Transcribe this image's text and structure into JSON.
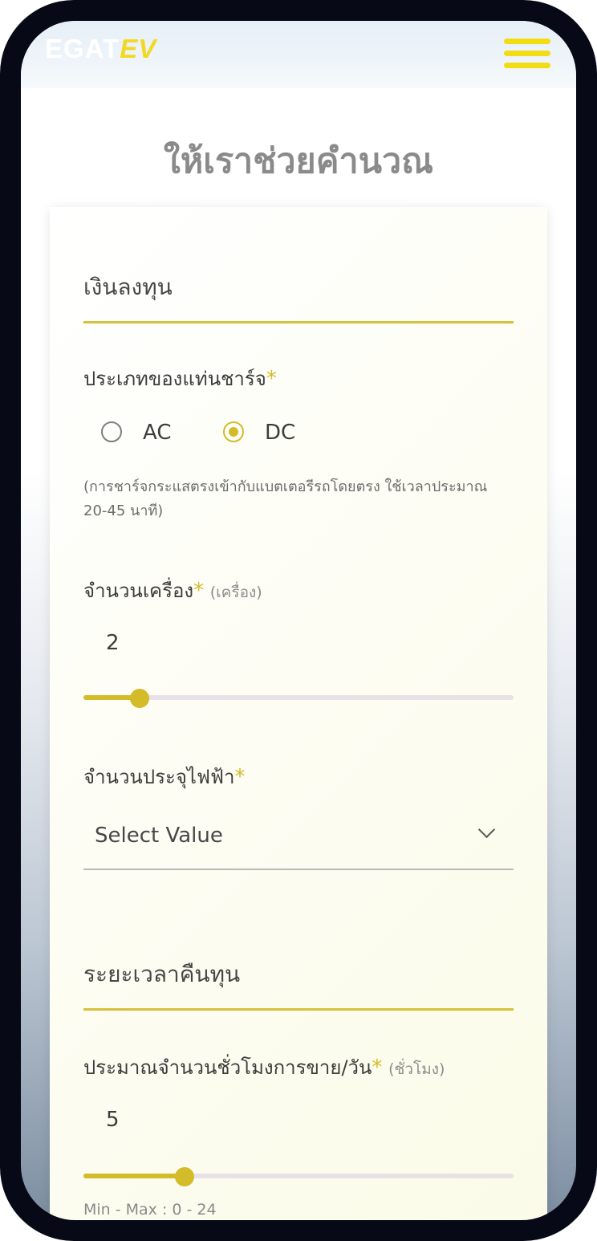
{
  "header": {
    "logo_main": "EGAT",
    "logo_ev": "EV",
    "logo_sub": "",
    "menu_icon": "hamburger-icon"
  },
  "page": {
    "title": "ให้เราช่วยคำนวณ"
  },
  "investment": {
    "section_title": "เงินลงทุน",
    "charger_type": {
      "label": "ประเภทของแท่นชาร์จ",
      "required": "*",
      "options": [
        "AC",
        "DC"
      ],
      "selected": "DC",
      "hint": "(การชาร์จกระแสตรงเข้ากับแบตเตอรีรถโดยตรง ใช้เวลาประมาณ 20-45 นาที)"
    },
    "machine_count": {
      "label": "จำนวนเครื่อง",
      "required": "*",
      "unit": "(เครื่อง)",
      "value": "2",
      "slider_fraction": 0.13
    },
    "power_rating": {
      "label": "จำนวนประจุไฟฟ้า",
      "required": "*",
      "selected_value": "Select Value"
    }
  },
  "payback": {
    "section_title": "ระยะเวลาคืนทุน",
    "sales_hours": {
      "label": "ประมาณจำนวนชั่วโมงการขาย/วัน",
      "required": "*",
      "unit": "(ชั่วโมง)",
      "value": "5",
      "slider_fraction": 0.235,
      "range": "Min - Max : 0 - 24"
    }
  },
  "colors": {
    "accent": "#d4bb2a",
    "menu": "#f2dc14",
    "frame": "#070a16"
  }
}
